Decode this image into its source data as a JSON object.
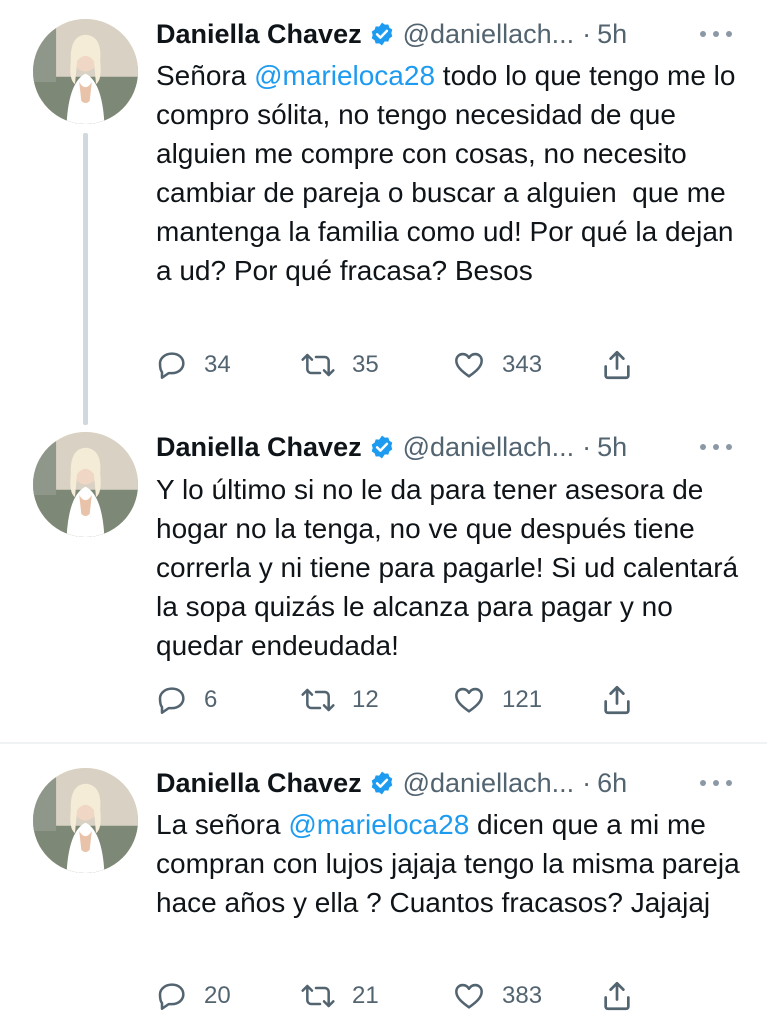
{
  "tweets": [
    {
      "name": "Daniella Chavez",
      "handle": "@daniellach...",
      "time": "5h",
      "text_before": "Señora ",
      "mention": "@marieloca28",
      "text_after": " todo lo que tengo me lo compro sólita, no tengo necesidad de que alguien me compre con cosas, no necesito cambiar de pareja o buscar a alguien  que me mantenga la familia como ud! Por qué la dejan a ud? Por qué fracasa? Besos",
      "replies": "34",
      "retweets": "35",
      "likes": "343"
    },
    {
      "name": "Daniella Chavez",
      "handle": "@daniellach...",
      "time": "5h",
      "text": "Y lo último si no le da para tener asesora de hogar no la tenga, no ve que después tiene correrla y ni tiene para pagarle! Si ud calentará la sopa quizás le alcanza para pagar y no quedar endeudada!",
      "replies": "6",
      "retweets": "12",
      "likes": "121"
    },
    {
      "name": "Daniella Chavez",
      "handle": "@daniellach...",
      "time": "6h",
      "text_before": "La señora ",
      "mention": "@marieloca28",
      "text_after": " dicen que a mi me compran con lujos jajaja tengo la misma pareja hace años y ella ? Cuantos fracasos? Jajajaj",
      "replies": "20",
      "retweets": "21",
      "likes": "383"
    }
  ],
  "separator": "·",
  "colors": {
    "verified": "#1d9bf0",
    "mention": "#1d9bf0",
    "secondary": "#536471"
  }
}
